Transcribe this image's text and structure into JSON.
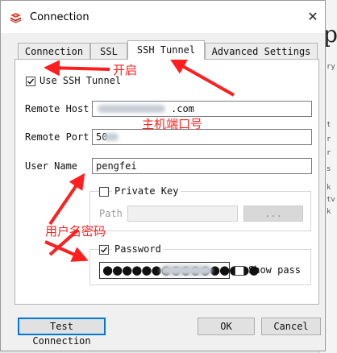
{
  "window": {
    "title": "Connection",
    "close_glyph": "✕"
  },
  "tabs": [
    {
      "label": "Connection",
      "active": false
    },
    {
      "label": "SSL",
      "active": false
    },
    {
      "label": "SSH Tunnel",
      "active": true
    },
    {
      "label": "Advanced Settings",
      "active": false
    }
  ],
  "ssh": {
    "use_tunnel_label": "Use SSH Tunnel",
    "use_tunnel_checked": true,
    "remote_host_label": "Remote Host",
    "remote_host_value": ".com",
    "remote_port_label": "Remote Port",
    "remote_port_value": "50",
    "user_name_label": "User Name",
    "user_name_value": "pengfei",
    "private_key_label": "Private Key",
    "private_key_checked": false,
    "path_label": "Path",
    "path_value": "",
    "browse_label": "...",
    "password_label": "Password",
    "password_checked": true,
    "password_mask": "●●●●●●●●●●●●●●●●",
    "show_pass_label": "Show pass",
    "show_pass_checked": false
  },
  "buttons": {
    "test": "Test Connection",
    "ok": "OK",
    "cancel": "Cancel"
  },
  "annotations": {
    "enable": "开启",
    "host_port": "主机端口号",
    "user_pass": "用户名密码",
    "color": "#ff1f1f"
  },
  "background": {
    "big_letter": "p",
    "snippets": [
      "ry",
      "t",
      "r",
      "r",
      "s",
      "k",
      "tv",
      "k"
    ]
  }
}
